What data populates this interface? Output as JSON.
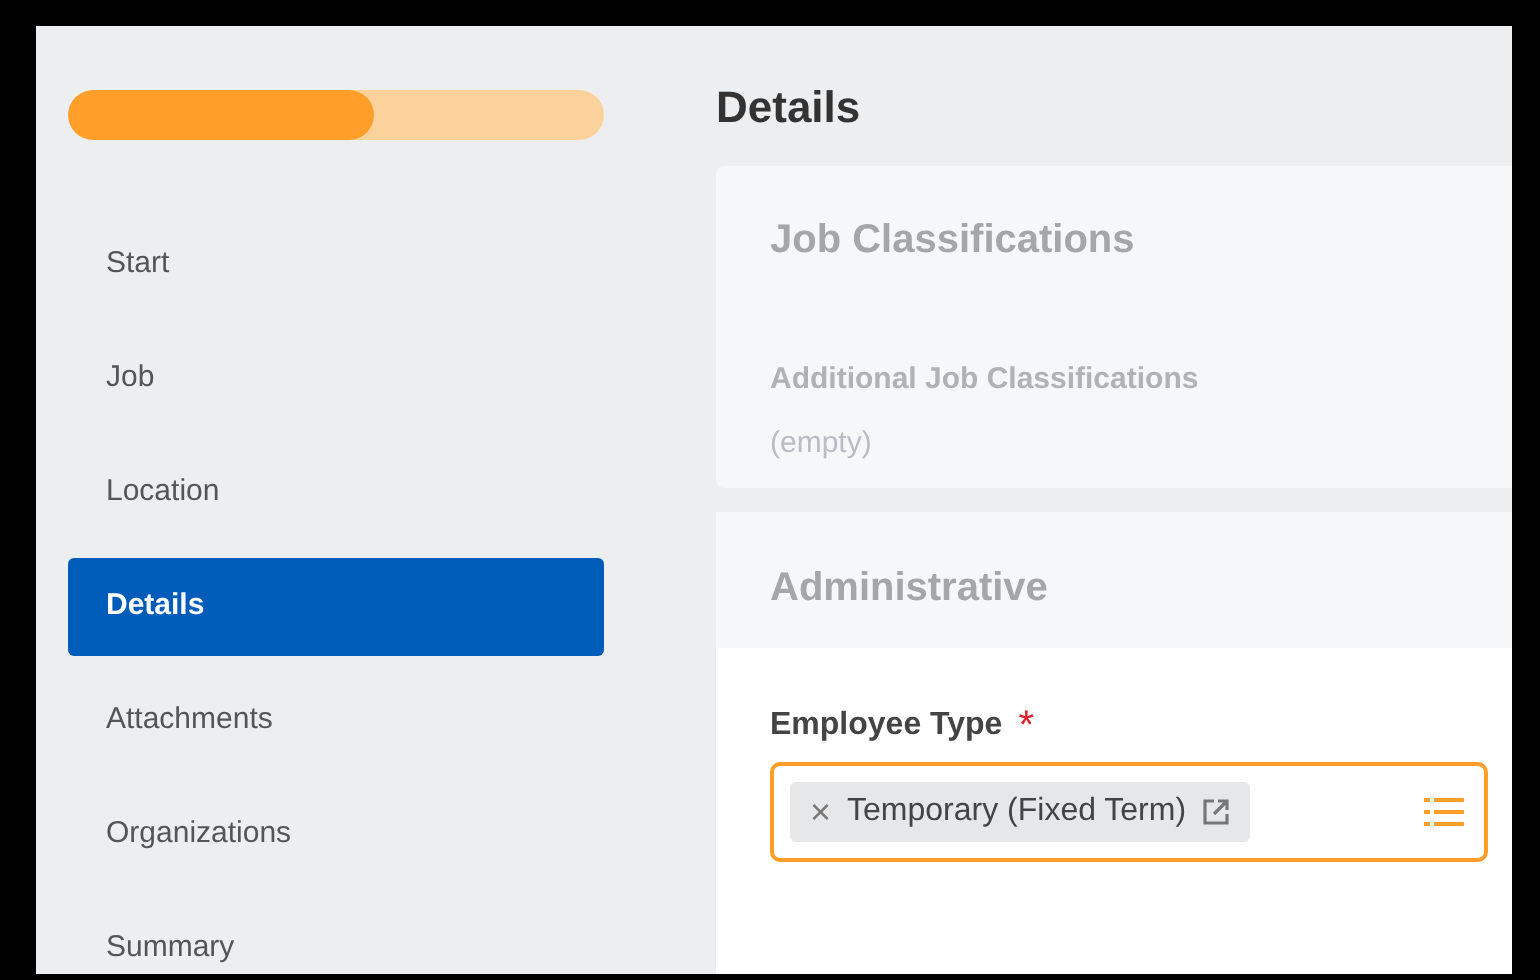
{
  "progress": {
    "level": 0.57
  },
  "steps": [
    {
      "label": "Start",
      "selected": false
    },
    {
      "label": "Job",
      "selected": false
    },
    {
      "label": "Location",
      "selected": false
    },
    {
      "label": "Details",
      "selected": true
    },
    {
      "label": "Attachments",
      "selected": false
    },
    {
      "label": "Organizations",
      "selected": false
    },
    {
      "label": "Summary",
      "selected": false
    }
  ],
  "page_title": "Details",
  "job_classifications": {
    "title": "Job Classifications",
    "field_label": "Additional Job Classifications",
    "value": "(empty)"
  },
  "administrative": {
    "title": "Administrative",
    "field": {
      "label": "Employee Type",
      "required_marker": "*",
      "chip": {
        "remove": "×",
        "label": "Temporary (Fixed Term)"
      }
    }
  }
}
